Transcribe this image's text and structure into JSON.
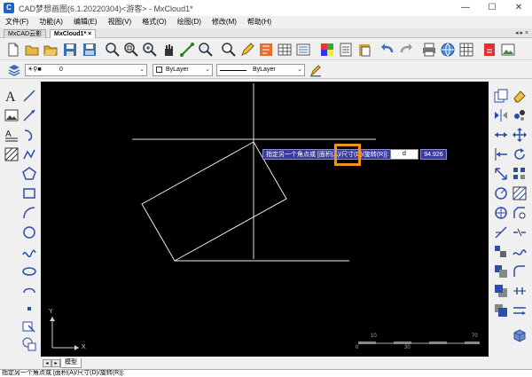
{
  "window": {
    "title": "CAD梦想画图(6.1.20220304)<游客> - MxCloud1*",
    "minimize": "—",
    "maximize": "☐",
    "close": "✕"
  },
  "menu": [
    "文件(F)",
    "功能(A)",
    "编辑(E)",
    "视图(V)",
    "格式(O)",
    "绘图(D)",
    "修改(M)",
    "帮助(H)"
  ],
  "tabs": [
    {
      "label": "MxCAD云影"
    },
    {
      "label": "MxCloud1*",
      "close": "×"
    }
  ],
  "tab_arrows": "◂ ▸ ×",
  "propbar": {
    "layer": "0",
    "color": "ByLayer",
    "linetype": "ByLayer"
  },
  "canvas": {
    "prompt": "指定另一个角点或 [面积(A)/尺寸(D)/旋转(R)]:",
    "input_value": "d",
    "readout": "94.926",
    "ucs_y": "Y",
    "ucs_x": "X",
    "scale_top_left": "10",
    "scale_top_right": "70",
    "scale_bottom_left": "0",
    "scale_bottom_mid": "30"
  },
  "layout": {
    "model_tab": "模型"
  },
  "command_line": "指定另一个角点或 [面积(A)/尺寸(D)/旋转(R)]:",
  "colors": {
    "canvas_bg": "#000000",
    "prompt_bg": "#3b3b9e",
    "highlight": "#f0921e"
  }
}
